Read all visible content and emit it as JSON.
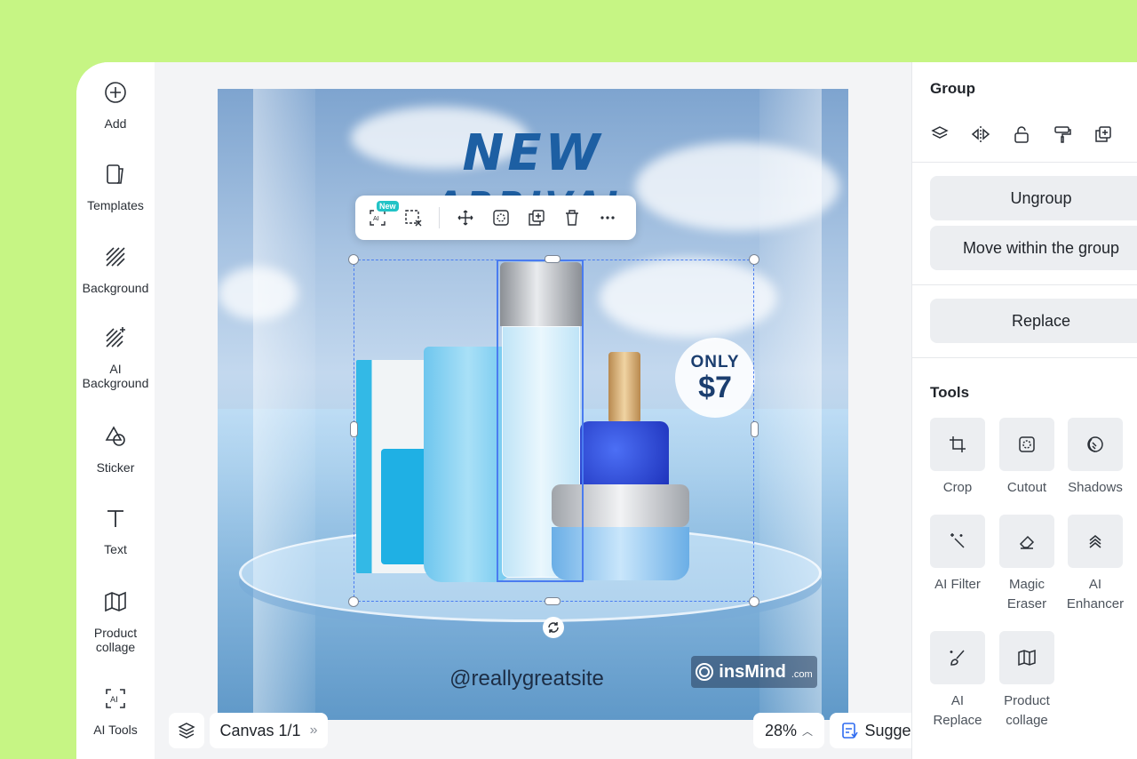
{
  "sidebar": {
    "items": [
      {
        "label": "Add",
        "icon": "plus-circle-icon"
      },
      {
        "label": "Templates",
        "icon": "templates-icon"
      },
      {
        "label": "Background",
        "icon": "background-icon"
      },
      {
        "label": "AI\nBackground",
        "icon": "ai-background-icon"
      },
      {
        "label": "Sticker",
        "icon": "sticker-icon"
      },
      {
        "label": "Text",
        "icon": "text-icon"
      },
      {
        "label": "Product\ncollage",
        "icon": "product-collage-icon"
      },
      {
        "label": "AI Tools",
        "icon": "ai-tools-icon"
      }
    ]
  },
  "canvas": {
    "headline": "NEW",
    "headline_partial": "ARRIVAL",
    "badge_top": "ONLY",
    "badge_price": "$7",
    "website": "@reallygreatsite",
    "logo_name": "insMind",
    "logo_suffix": ".com",
    "colors": {
      "headline": "#1d5fa3",
      "selection": "#4a7cf0"
    }
  },
  "context_toolbar": {
    "new_badge": "New",
    "items": [
      "ai-edit-icon",
      "deselect-icon",
      "move-icon",
      "cutout-icon",
      "duplicate-icon",
      "trash-icon",
      "more-icon"
    ]
  },
  "bottom_bar": {
    "canvas_label": "Canvas 1/1",
    "zoom": "28%",
    "suggest": "Suggest",
    "help": "?"
  },
  "panel": {
    "group_title": "Group",
    "group_icons": [
      "layers-icon",
      "flip-icon",
      "lock-icon",
      "paint-format-icon",
      "duplicate-icon"
    ],
    "ungroup": "Ungroup",
    "move_within": "Move within the group",
    "replace": "Replace",
    "tools_title": "Tools",
    "tools": [
      {
        "label": "Crop",
        "icon": "crop-icon"
      },
      {
        "label": "Cutout",
        "icon": "cutout-icon"
      },
      {
        "label": "Shadows",
        "icon": "shadows-icon"
      },
      {
        "label": "AI Filter",
        "icon": "ai-filter-icon"
      },
      {
        "label": "Magic\nEraser",
        "icon": "eraser-icon"
      },
      {
        "label": "AI\nEnhancer",
        "icon": "enhancer-icon"
      },
      {
        "label": "AI\nReplace",
        "icon": "ai-replace-icon"
      },
      {
        "label": "Product\ncollage",
        "icon": "product-collage-icon"
      }
    ]
  },
  "theme": {
    "accent": "#4a7cf0",
    "frame_bg": "#c6f584",
    "teal_badge": "#22c3c6"
  }
}
